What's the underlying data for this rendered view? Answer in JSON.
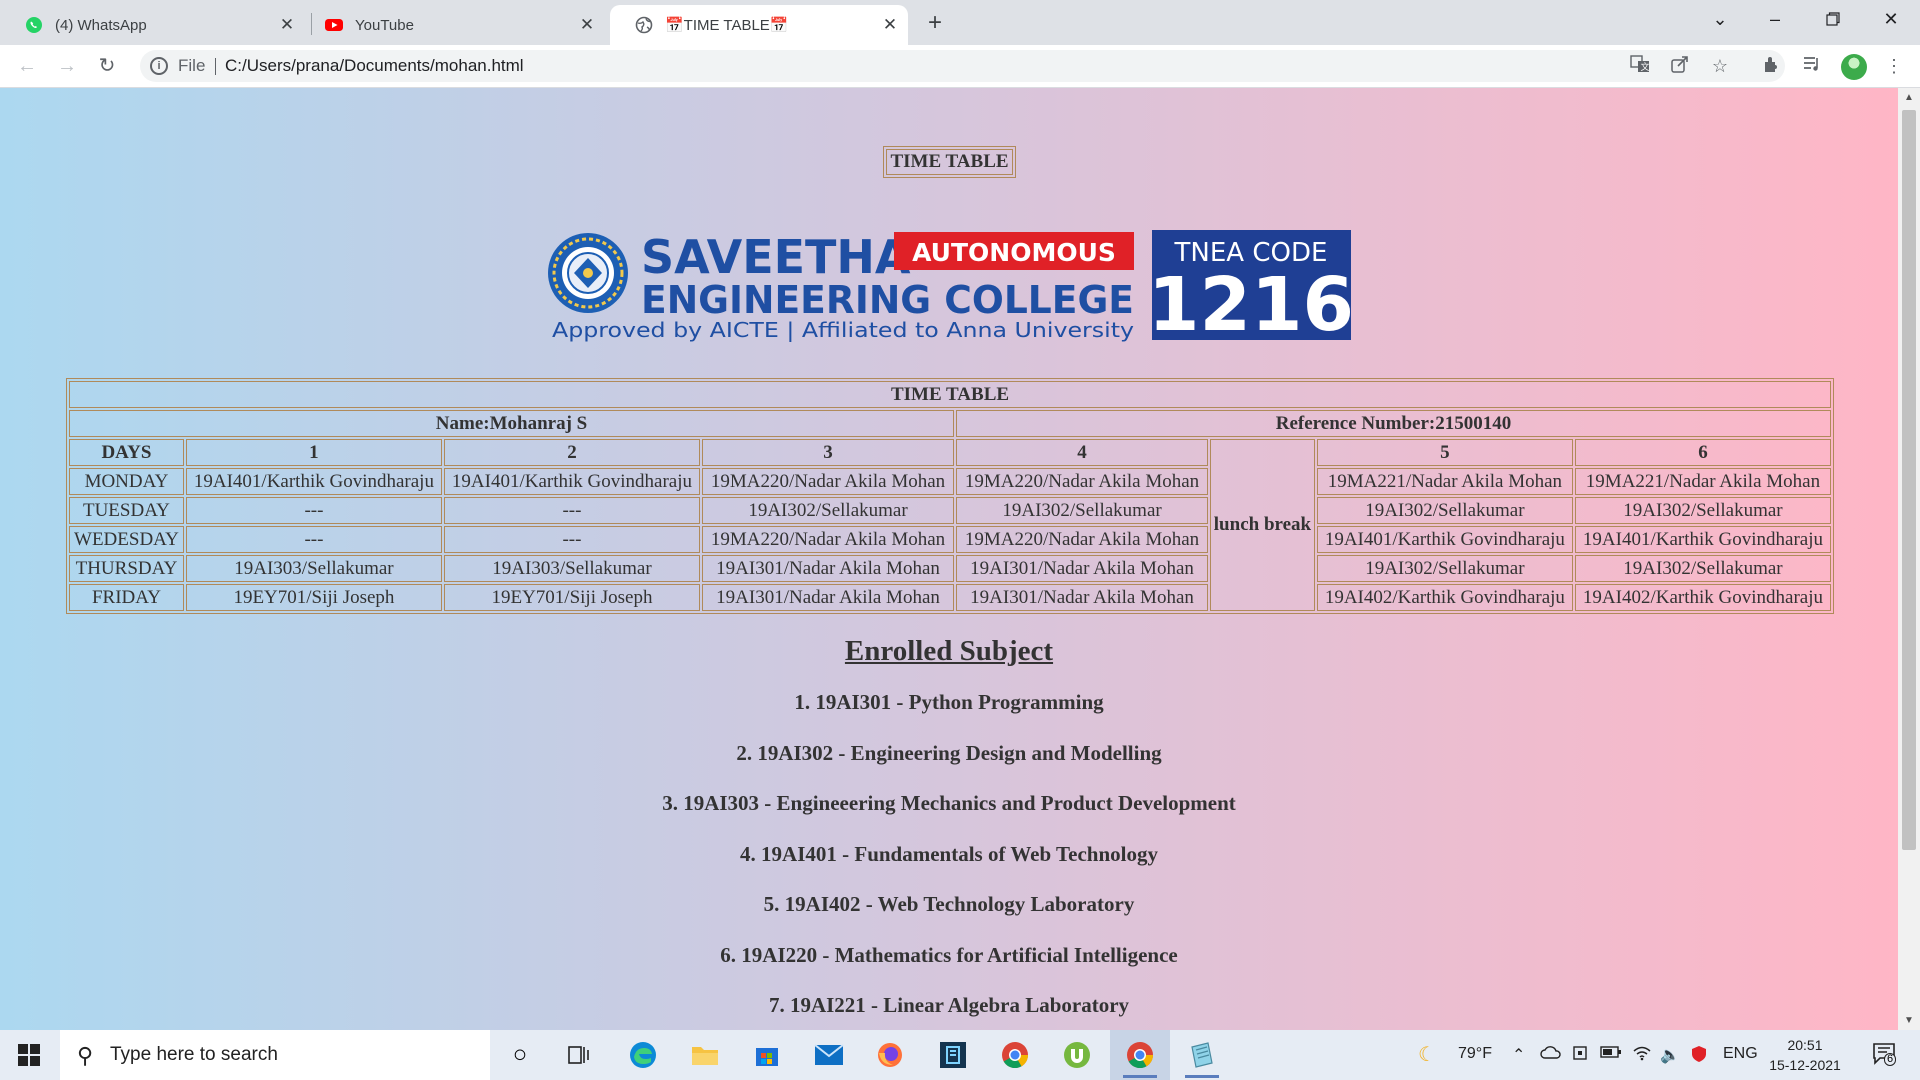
{
  "browser": {
    "tabs": [
      {
        "title": "(4) WhatsApp",
        "icon": "whatsapp-icon",
        "active": false
      },
      {
        "title": "YouTube",
        "icon": "youtube-icon",
        "active": false
      },
      {
        "title": "📅TIME TABLE📅",
        "icon": "globe-icon",
        "active": true
      }
    ],
    "new_tab": "+",
    "close_glyph": "✕",
    "url_scheme": "File",
    "url": "C:/Users/prana/Documents/mohan.html"
  },
  "page": {
    "heading": "TIME TABLE",
    "logo": {
      "name": "SAVEETHA",
      "name_line2": "ENGINEERING COLLEGE",
      "badge": "AUTONOMOUS",
      "tagline": "Approved by AICTE | Affiliated to Anna University",
      "code_label": "TNEA CODE",
      "code": "1216"
    },
    "timetable": {
      "title": "TIME TABLE",
      "name": "Name:Mohanraj S",
      "reference": "Reference Number:21500140",
      "header": [
        "DAYS",
        "1",
        "2",
        "3",
        "4",
        "5",
        "6"
      ],
      "lunch": "lunch break",
      "rows": [
        {
          "day": "MONDAY",
          "p1": "19AI401/Karthik Govindharaju",
          "p2": "19AI401/Karthik Govindharaju",
          "p3": "19MA220/Nadar Akila Mohan",
          "p4": "19MA220/Nadar Akila Mohan",
          "p5": "19MA221/Nadar Akila Mohan",
          "p6": "19MA221/Nadar Akila Mohan"
        },
        {
          "day": "TUESDAY",
          "p1": "---",
          "p2": "---",
          "p3": "19AI302/Sellakumar",
          "p4": "19AI302/Sellakumar",
          "p5": "19AI302/Sellakumar",
          "p6": "19AI302/Sellakumar"
        },
        {
          "day": "WEDESDAY",
          "p1": "---",
          "p2": "---",
          "p3": "19MA220/Nadar Akila Mohan",
          "p4": "19MA220/Nadar Akila Mohan",
          "p5": "19AI401/Karthik Govindharaju",
          "p6": "19AI401/Karthik Govindharaju"
        },
        {
          "day": "THURSDAY",
          "p1": "19AI303/Sellakumar",
          "p2": "19AI303/Sellakumar",
          "p3": "19AI301/Nadar Akila Mohan",
          "p4": "19AI301/Nadar Akila Mohan",
          "p5": "19AI302/Sellakumar",
          "p6": "19AI302/Sellakumar"
        },
        {
          "day": "FRIDAY",
          "p1": "19EY701/Siji Joseph",
          "p2": "19EY701/Siji Joseph",
          "p3": "19AI301/Nadar Akila Mohan",
          "p4": "19AI301/Nadar Akila Mohan",
          "p5": "19AI402/Karthik Govindharaju",
          "p6": "19AI402/Karthik Govindharaju"
        }
      ]
    },
    "enrolled": {
      "title": "Enrolled Subject",
      "items": [
        "1. 19AI301 - Python Programming",
        "2. 19AI302 - Engineering Design and Modelling",
        "3. 19AI303 - Engineeering Mechanics and Product Development",
        "4. 19AI401 - Fundamentals of Web Technology",
        "5. 19AI402 - Web Technology Laboratory",
        "6. 19AI220 - Mathematics for Artificial Intelligence",
        "7. 19AI221 - Linear Algebra Laboratory"
      ]
    }
  },
  "taskbar": {
    "search_placeholder": "Type here to search",
    "weather": "79°F",
    "language": "ENG",
    "time": "20:51",
    "date": "15-12-2021",
    "notifications": "6",
    "apps": [
      "cortana-icon",
      "task-view-icon",
      "edge-icon",
      "file-explorer-icon",
      "store-icon",
      "mail-icon",
      "firefox-icon",
      "app-icon",
      "chrome-icon",
      "utorrent-icon",
      "chrome-icon",
      "notepad-icon"
    ]
  }
}
